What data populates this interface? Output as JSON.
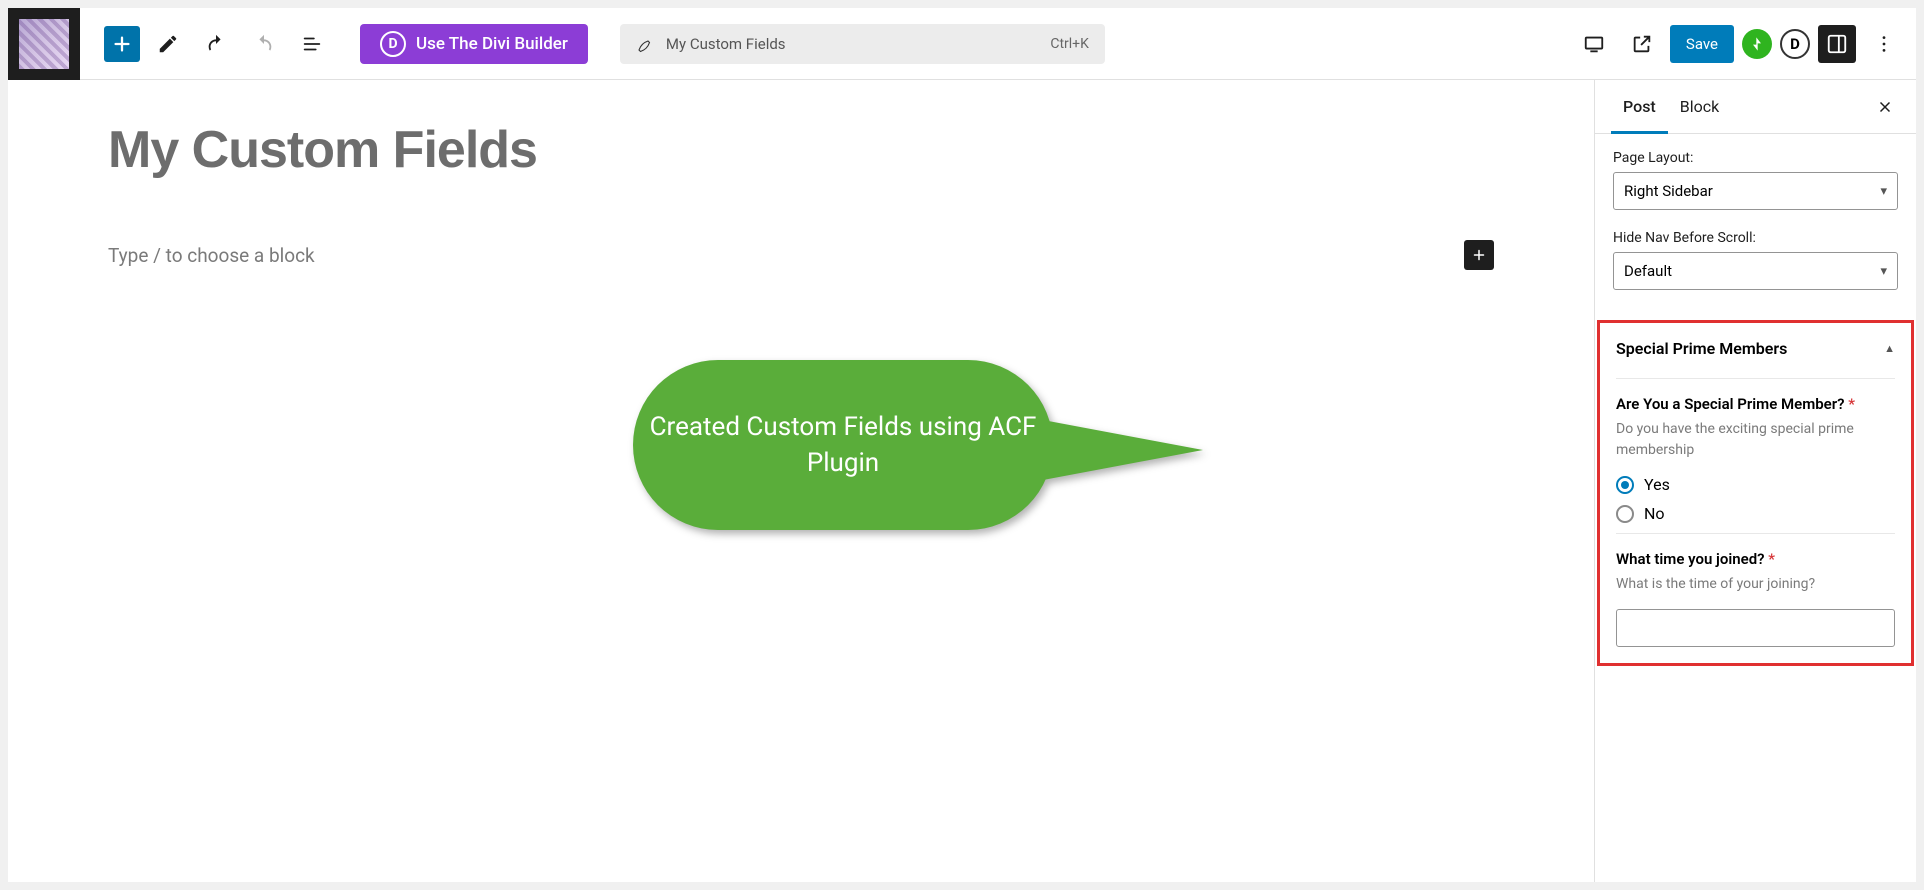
{
  "toolbar": {
    "diviButton": "Use The Divi Builder",
    "titleField": "My Custom Fields",
    "shortcut": "Ctrl+K",
    "save": "Save"
  },
  "editor": {
    "title": "My Custom Fields",
    "blockPlaceholder": "Type / to choose a block"
  },
  "callout": {
    "text": "Created Custom Fields using ACF Plugin"
  },
  "sidebar": {
    "tabs": {
      "post": "Post",
      "block": "Block"
    },
    "pageLayout": {
      "label": "Page Layout:",
      "value": "Right Sidebar"
    },
    "hideNav": {
      "label": "Hide Nav Before Scroll:",
      "value": "Default"
    },
    "acf": {
      "panelTitle": "Special Prime Members",
      "q1": {
        "label": "Are You a Special Prime Member?",
        "desc": "Do you have the exciting special prime membership",
        "optYes": "Yes",
        "optNo": "No"
      },
      "q2": {
        "label": "What time you joined?",
        "desc": "What is the time of your joining?"
      }
    }
  }
}
